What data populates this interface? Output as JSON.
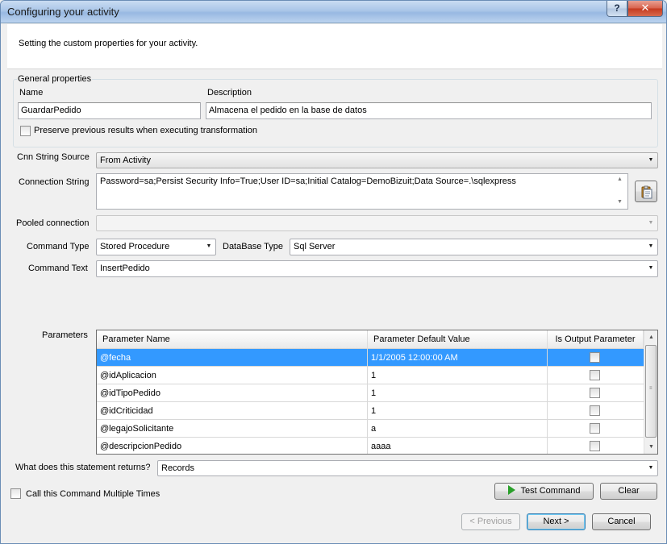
{
  "window": {
    "title": "Configuring your activity",
    "help_label": "?",
    "close_label": "✕"
  },
  "header": {
    "text": "Setting the custom properties for your activity."
  },
  "general": {
    "group_label": "General properties",
    "name_label": "Name",
    "name_value": "GuardarPedido",
    "description_label": "Description",
    "description_value": "Almacena el pedido en la base de datos",
    "preserve_label": "Preserve previous results when executing transformation",
    "preserve_checked": false
  },
  "connection": {
    "cnn_source_label": "Cnn String Source",
    "cnn_source_value": "From Activity",
    "string_label": "Connection String",
    "string_value": "Password=sa;Persist Security Info=True;User ID=sa;Initial Catalog=DemoBizuit;Data Source=.\\sqlexpress",
    "browse_icon": "clipboard-icon",
    "pooled_label": "Pooled connection",
    "pooled_value": ""
  },
  "command": {
    "type_label": "Command Type",
    "type_value": "Stored Procedure",
    "db_type_label": "DataBase Type",
    "db_type_value": "Sql Server",
    "text_label": "Command Text",
    "text_value": "InsertPedido"
  },
  "parameters": {
    "label": "Parameters",
    "columns": [
      "Parameter Name",
      "Parameter Default Value",
      "Is Output Parameter"
    ],
    "rows": [
      {
        "name": "@fecha",
        "default": "1/1/2005 12:00:00 AM",
        "output": false,
        "selected": true
      },
      {
        "name": "@idAplicacion",
        "default": "1",
        "output": false,
        "selected": false
      },
      {
        "name": "@idTipoPedido",
        "default": "1",
        "output": false,
        "selected": false
      },
      {
        "name": "@idCriticidad",
        "default": "1",
        "output": false,
        "selected": false
      },
      {
        "name": "@legajoSolicitante",
        "default": "a",
        "output": false,
        "selected": false
      },
      {
        "name": "@descripcionPedido",
        "default": "aaaa",
        "output": false,
        "selected": false
      }
    ]
  },
  "returns": {
    "label": "What does this statement returns?",
    "value": "Records"
  },
  "footer": {
    "multiple_label": "Call this Command Multiple Times",
    "multiple_checked": false,
    "test_label": "Test Command",
    "clear_label": "Clear",
    "previous_label": "< Previous",
    "next_label": "Next >",
    "cancel_label": "Cancel"
  }
}
